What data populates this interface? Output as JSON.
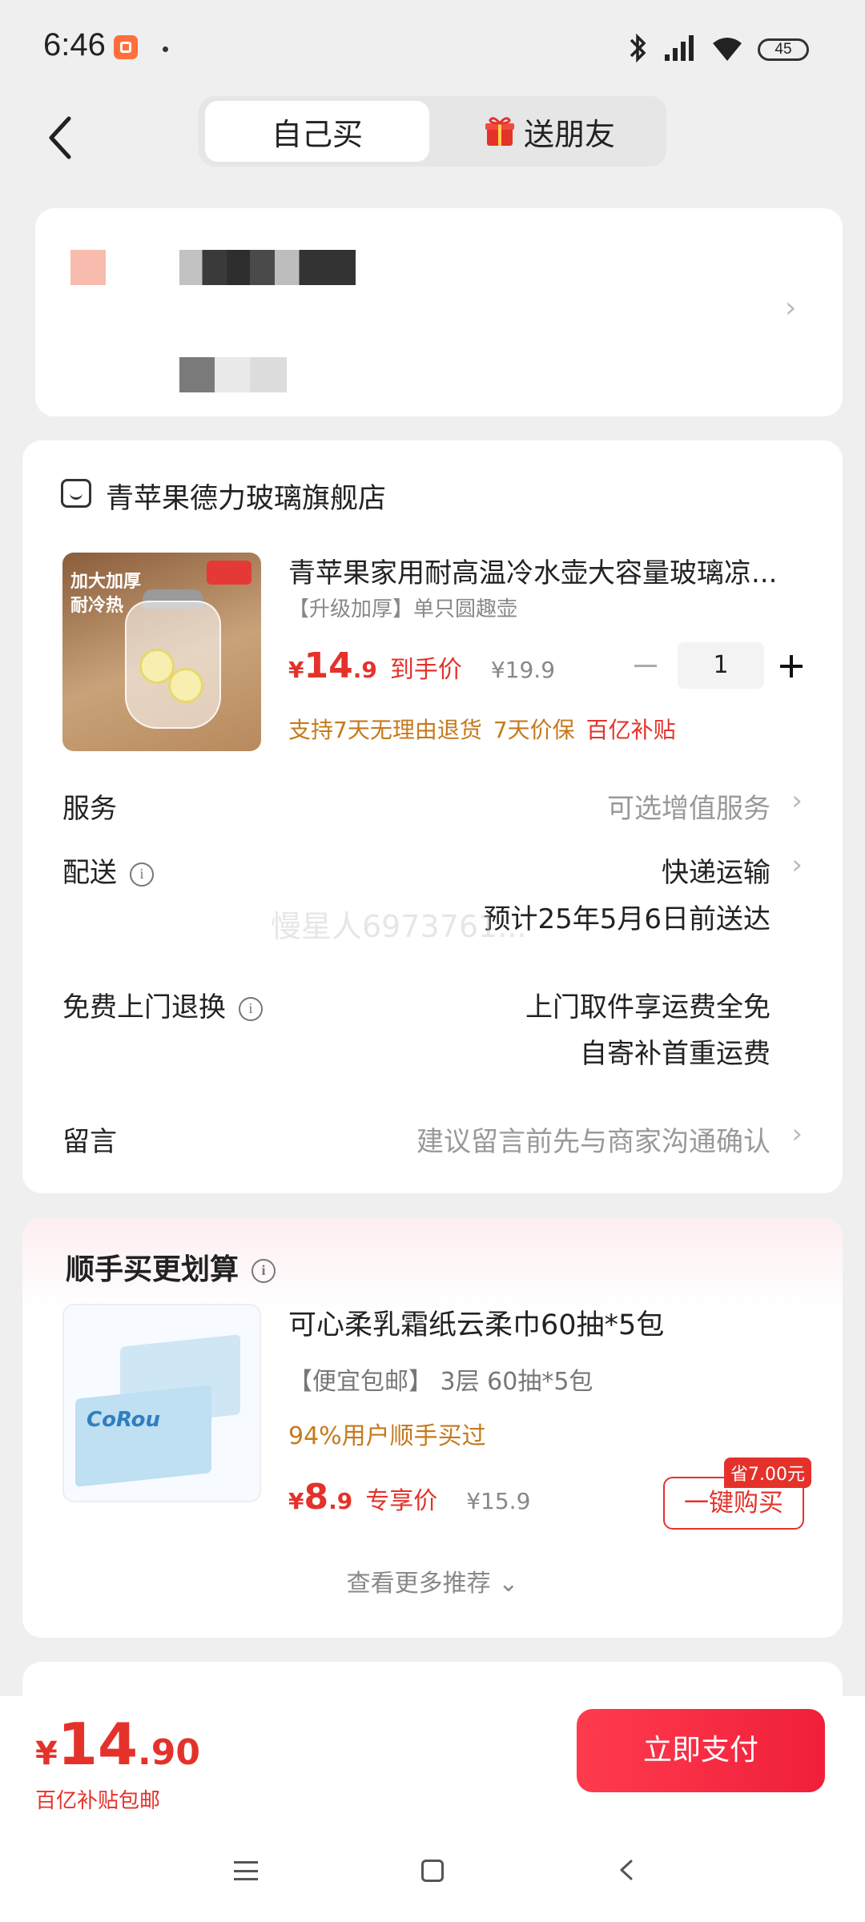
{
  "status_bar": {
    "time": "6:46",
    "battery": "45"
  },
  "header": {
    "tabs": [
      {
        "label": "自己买",
        "active": true
      },
      {
        "label": "送朋友",
        "active": false
      }
    ]
  },
  "shop": {
    "name": "青苹果德力玻璃旗舰店",
    "product": {
      "title": "青苹果家用耐高温冷水壶大容量玻璃凉...",
      "spec": "【升级加厚】单只圆趣壶",
      "price_symbol": "¥",
      "price_int": "14",
      "price_dec": ".9",
      "price_tag": "到手价",
      "original_price": "¥19.9",
      "quantity": "1",
      "image_text": [
        "加大加厚",
        "耐冷热"
      ],
      "promos": [
        "支持7天无理由退货",
        "7天价保",
        "百亿补贴"
      ]
    },
    "service": {
      "label": "服务",
      "value": "可选增值服务"
    },
    "delivery": {
      "label": "配送",
      "value": "快递运输",
      "eta": "预计25年5月6日前送达"
    },
    "returns": {
      "label": "免费上门退换",
      "line1": "上门取件享运费全免",
      "line2": "自寄补首重运费"
    },
    "message": {
      "label": "留言",
      "placeholder": "建议留言前先与商家沟通确认"
    },
    "watermark": "慢星人6973761..."
  },
  "recommend": {
    "title": "顺手买更划算",
    "name": "可心柔乳霜纸云柔巾60抽*5包",
    "spec": "【便宜包邮】 3层 60抽*5包",
    "social": "94%用户顺手买过",
    "price_symbol": "¥",
    "price_int": "8",
    "price_dec": ".9",
    "price_tag": "专享价",
    "original_price": "¥15.9",
    "save_badge": "省7.00元",
    "buy_label": "一键购买",
    "more_label": "查看更多推荐",
    "image_brand": "CoRou"
  },
  "checkout": {
    "symbol": "¥",
    "int": "14",
    "dec": ".90",
    "note": "百亿补贴包邮",
    "pay_label": "立即支付"
  },
  "colors": {
    "accent": "#e4322b",
    "promo": "#c57a1c",
    "background": "#efefef"
  }
}
